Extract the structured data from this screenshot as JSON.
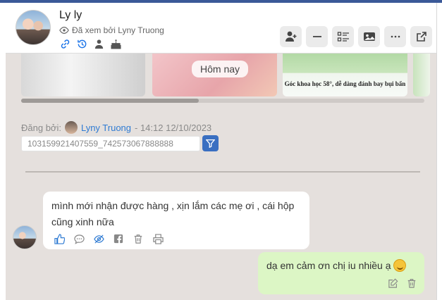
{
  "header": {
    "title": "Ly ly",
    "seen_by": "Đã xem bởi Lyny Truong"
  },
  "gallery": {
    "date_chip": "Hôm nay",
    "caption": "Góc khoa học 58°, dễ dàng đánh bay bụi bẩn"
  },
  "post": {
    "label": "Đăng bởi:",
    "author": "Lyny Truong",
    "time": "- 14:12 12/10/2023",
    "id": "103159921407559_742573067888888"
  },
  "messages": {
    "incoming": "mình mới nhận được hàng , xịn lắm các mẹ ơi , cái hộp cũng xinh nữa",
    "outgoing": "dạ em cảm ơn chị iu nhiều ạ"
  },
  "colors": {
    "accent": "#3a6fc1",
    "link": "#2f7bd3",
    "chat_bg": "#e5e0dd",
    "outgoing_bubble": "#dcf6c5"
  },
  "icons": [
    "link-icon",
    "history-icon",
    "user-icon",
    "cake-icon",
    "eye-icon",
    "add-user-icon",
    "minus-icon",
    "list-icon",
    "photo-icon",
    "more-icon",
    "external-link-icon",
    "filter-icon",
    "like-icon",
    "comment-icon",
    "hide-icon",
    "facebook-icon",
    "trash-icon",
    "print-icon",
    "edit-icon"
  ]
}
